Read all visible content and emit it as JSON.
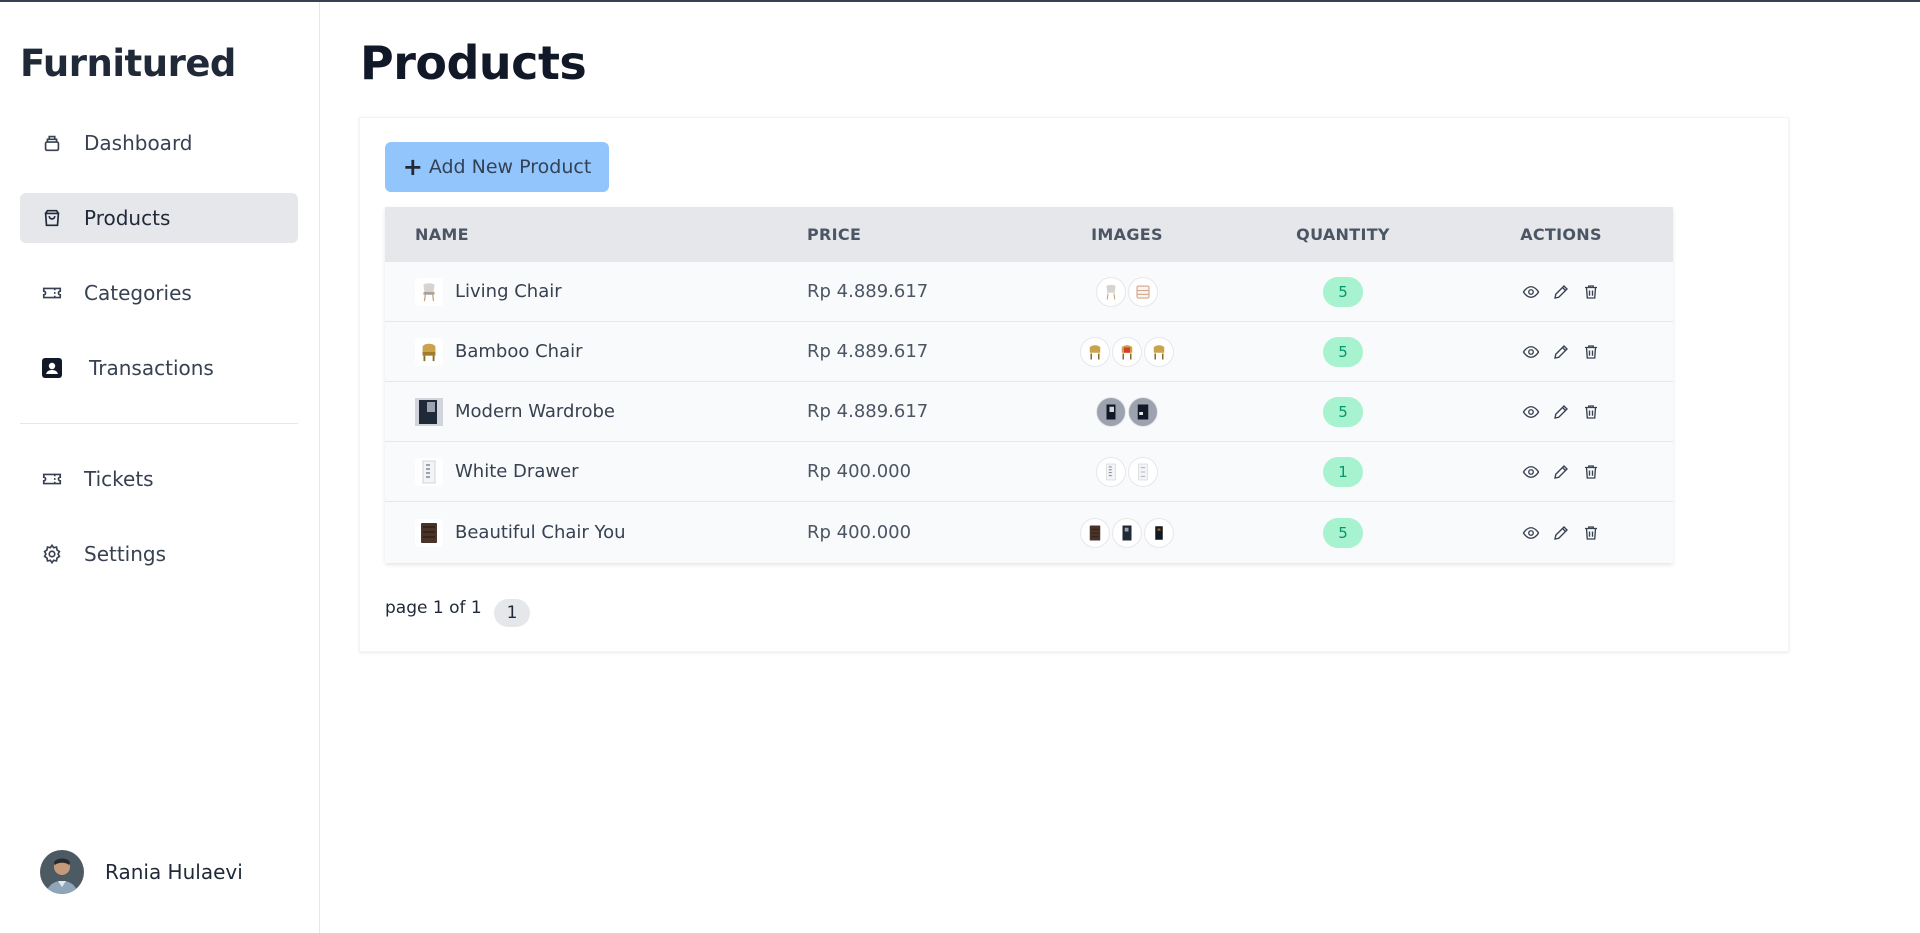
{
  "brand": "Furnitured",
  "sidebar": {
    "items": [
      {
        "label": "Dashboard",
        "icon": "archive-box-icon",
        "active": false
      },
      {
        "label": "Products",
        "icon": "shopping-bag-icon",
        "active": true
      },
      {
        "label": "Categories",
        "icon": "ticket-icon",
        "active": false
      },
      {
        "label": "Transactions",
        "icon": "contact-card-icon",
        "active": false
      },
      {
        "label": "Tickets",
        "icon": "ticket-icon",
        "active": false
      },
      {
        "label": "Settings",
        "icon": "gear-icon",
        "active": false
      }
    ]
  },
  "user": {
    "name": "Rania Hulaevi"
  },
  "page": {
    "title": "Products"
  },
  "toolbar": {
    "add_label": "Add New Product"
  },
  "table": {
    "headers": {
      "name": "NAME",
      "price": "PRICE",
      "images": "IMAGES",
      "quantity": "QUANTITY",
      "actions": "ACTIONS"
    },
    "rows": [
      {
        "name": "Living Chair",
        "price": "Rp 4.889.617",
        "quantity": "5",
        "image_count": 2
      },
      {
        "name": "Bamboo Chair",
        "price": "Rp 4.889.617",
        "quantity": "5",
        "image_count": 3
      },
      {
        "name": "Modern Wardrobe",
        "price": "Rp 4.889.617",
        "quantity": "5",
        "image_count": 2
      },
      {
        "name": "White Drawer",
        "price": "Rp 400.000",
        "quantity": "1",
        "image_count": 2
      },
      {
        "name": "Beautiful Chair You",
        "price": "Rp 400.000",
        "quantity": "5",
        "image_count": 3
      }
    ]
  },
  "pagination": {
    "info": "page 1 of 1",
    "current": "1"
  },
  "colors": {
    "accent_button": "#93c5fd",
    "active_nav": "#e5e7eb",
    "qty_badge_bg": "#a7f3d0",
    "qty_badge_text": "#059669"
  }
}
